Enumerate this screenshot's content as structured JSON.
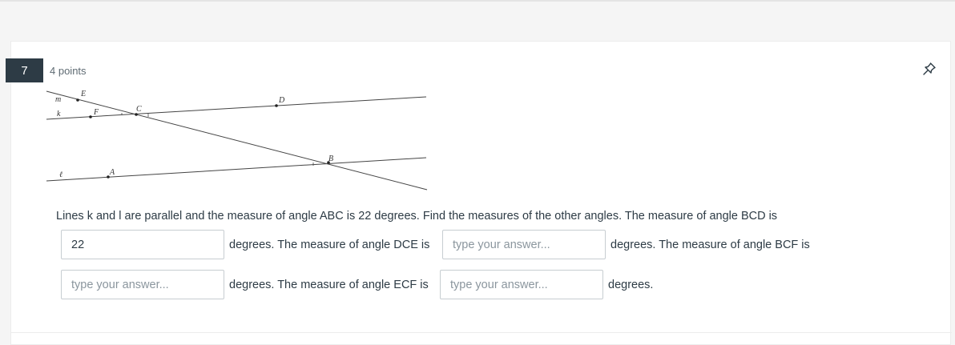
{
  "question": {
    "number": "7",
    "points": "4 points",
    "prompt": "Lines k and l are parallel and the measure of angle ABC is 22 degrees. Find the measures of the other angles.  The measure of angle BCD is",
    "segments": [
      "degrees. The measure of angle DCE is",
      "degrees. The measure of angle BCF is",
      "degrees. The measure of angle ECF is",
      "degrees."
    ],
    "answers": [
      {
        "value": "22",
        "placeholder": ""
      },
      {
        "value": "",
        "placeholder": "type your answer..."
      },
      {
        "value": "",
        "placeholder": "type your answer..."
      },
      {
        "value": "",
        "placeholder": "type your answer..."
      }
    ],
    "pin_icon": "pin-icon"
  },
  "diagram": {
    "line_labels": {
      "m": "m",
      "k": "k",
      "l": "ℓ"
    },
    "point_labels": {
      "E": "E",
      "F": "F",
      "C": "C",
      "D": "D",
      "B": "B",
      "A": "A"
    }
  }
}
